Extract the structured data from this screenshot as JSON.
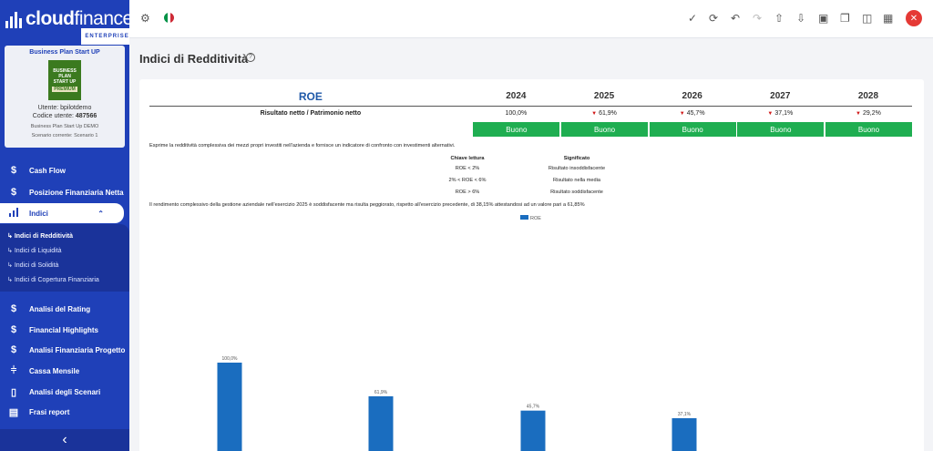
{
  "brand": {
    "name_part1": "cloud",
    "name_part2": "finance",
    "edition": "ENTERPRISE"
  },
  "plan_card": {
    "title": "Business Plan Start UP",
    "image_line1": "BUSINESS PLAN",
    "image_line2": "START UP",
    "image_badge": "PREMIUM",
    "user": "Utente: bpilotdemo",
    "code_label": "Codice utente:",
    "code": "487566",
    "plan_name": "Business Plan Start Up DEMO",
    "scenario": "Scenario corrente: Scenario 1"
  },
  "sidebar": {
    "cash_flow": "Cash Flow",
    "posizione": "Posizione Finanziaria Netta",
    "indici": "Indici",
    "sub": [
      "Indici di Redditività",
      "Indici di Liquidità",
      "Indici di Solidità",
      "Indici di Copertura Finanziaria"
    ],
    "rating": "Analisi del Rating",
    "highlights": "Financial Highlights",
    "progetto": "Analisi Finanziaria Progetto",
    "cassa": "Cassa Mensile",
    "scenari": "Analisi degli Scenari",
    "frasi": "Frasi report"
  },
  "page": {
    "title": "Indici di Redditività"
  },
  "roe_table": {
    "label": "ROE",
    "row_label": "Risultato netto / Patrimonio netto",
    "years": [
      "2024",
      "2025",
      "2026",
      "2027",
      "2028"
    ],
    "values": [
      "100,0%",
      "61,9%",
      "45,7%",
      "37,1%",
      "29,2%"
    ],
    "trend_down": [
      false,
      true,
      true,
      true,
      true
    ],
    "ratings": [
      "Buono",
      "Buono",
      "Buono",
      "Buono",
      "Buono"
    ]
  },
  "description": "Esprime la redditività complessiva dei mezzi propri investiti nell'azienda e fornisce un indicatore di confronto con investimenti alternativi.",
  "legend_table": {
    "col1_header": "Chiave lettura",
    "col2_header": "Significato",
    "rows": [
      {
        "key": "ROE < 2%",
        "meaning": "Risultato insoddisfacente"
      },
      {
        "key": "2% < ROE < 6%",
        "meaning": "Risultato nella media"
      },
      {
        "key": "ROE > 6%",
        "meaning": "Risultato soddisfacente"
      }
    ]
  },
  "conclusion": "Il rendimento complessivo della gestione aziendale nell'esercizio 2025 è soddisfacente ma risulta peggiorato, rispetto all'esercizio precedente, di 38,15% attestandosi ad un valore pari a 61,85%",
  "colors": {
    "sidebar": "#1f40b8",
    "accent": "#1f59a8",
    "good": "#1fae51",
    "bar": "#1a6dbf",
    "down": "#d01818"
  },
  "chart_data": {
    "type": "bar",
    "legend": [
      "ROE"
    ],
    "legend_position": "top-center",
    "series": [
      {
        "name": "ROE",
        "values": [
          100.0,
          61.9,
          45.7,
          37.1
        ]
      }
    ],
    "data_labels": [
      "100,0%",
      "61,9%",
      "45,7%",
      "37,1%"
    ],
    "y_max": 100,
    "grid": false
  }
}
